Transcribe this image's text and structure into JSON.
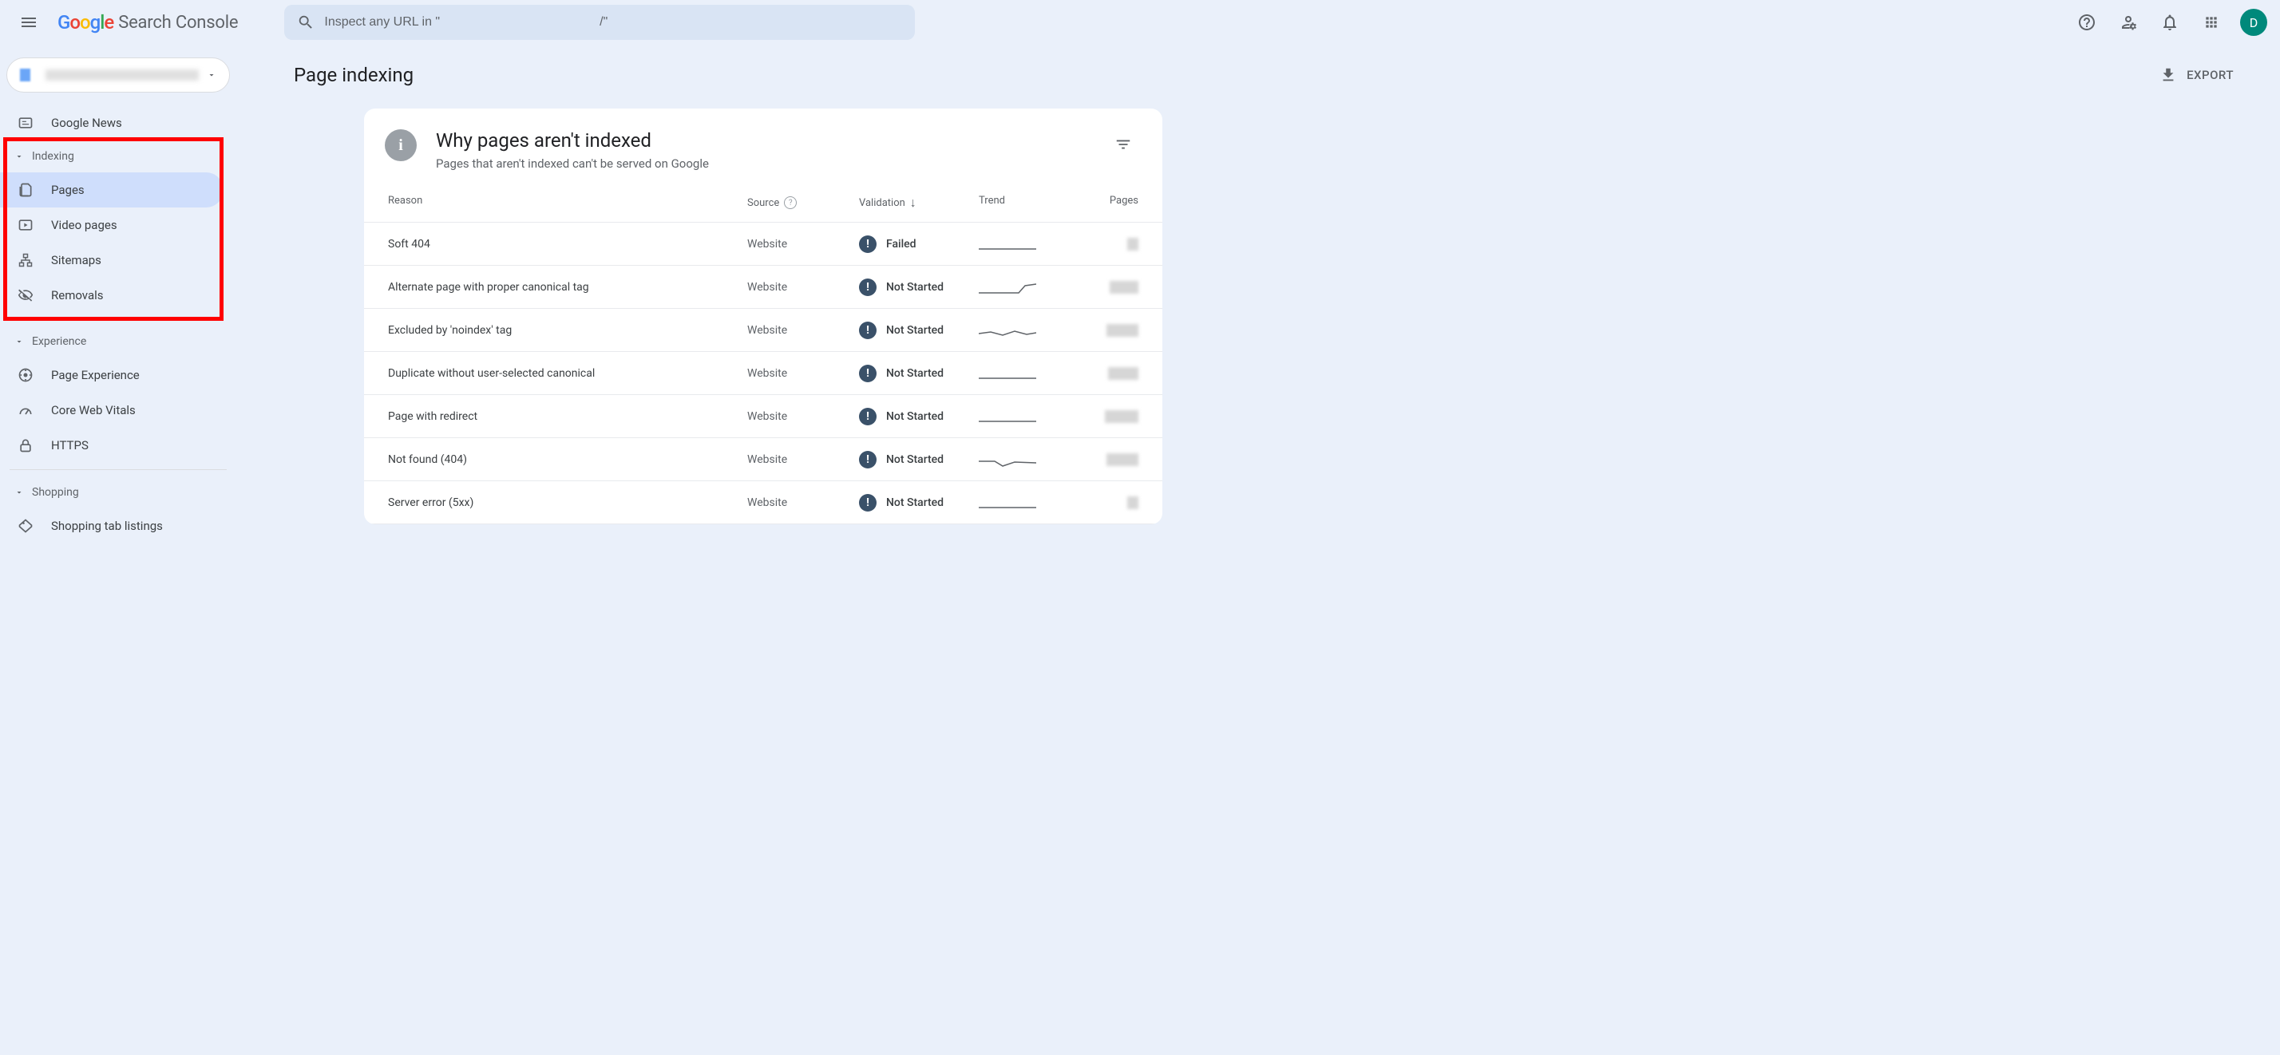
{
  "app": {
    "product_name": "Search Console",
    "search_placeholder": "Inspect any URL in \"                                             /\"",
    "avatar_letter": "D"
  },
  "sidebar": {
    "google_news": "Google News",
    "groups": {
      "indexing": {
        "label": "Indexing",
        "items": [
          {
            "label": "Pages",
            "icon": "pages-icon",
            "selected": true
          },
          {
            "label": "Video pages",
            "icon": "video-pages-icon"
          },
          {
            "label": "Sitemaps",
            "icon": "sitemaps-icon"
          },
          {
            "label": "Removals",
            "icon": "removals-icon"
          }
        ]
      },
      "experience": {
        "label": "Experience",
        "items": [
          {
            "label": "Page Experience",
            "icon": "page-experience-icon"
          },
          {
            "label": "Core Web Vitals",
            "icon": "core-web-vitals-icon"
          },
          {
            "label": "HTTPS",
            "icon": "https-icon"
          }
        ]
      },
      "shopping": {
        "label": "Shopping",
        "items": [
          {
            "label": "Shopping tab listings",
            "icon": "shopping-icon"
          }
        ]
      }
    }
  },
  "page": {
    "title": "Page indexing",
    "export_label": "EXPORT"
  },
  "card": {
    "title": "Why pages aren't indexed",
    "subtitle": "Pages that aren't indexed can't be served on Google",
    "columns": {
      "reason": "Reason",
      "source": "Source",
      "validation": "Validation",
      "trend": "Trend",
      "pages": "Pages"
    },
    "rows": [
      {
        "reason": "Soft 404",
        "source": "Website",
        "validation": "Failed",
        "trend": "flat",
        "pages_w": 14
      },
      {
        "reason": "Alternate page with proper canonical tag",
        "source": "Website",
        "validation": "Not Started",
        "trend": "up",
        "pages_w": 36
      },
      {
        "reason": "Excluded by 'noindex' tag",
        "source": "Website",
        "validation": "Not Started",
        "trend": "wavy",
        "pages_w": 40
      },
      {
        "reason": "Duplicate without user-selected canonical",
        "source": "Website",
        "validation": "Not Started",
        "trend": "flat",
        "pages_w": 38
      },
      {
        "reason": "Page with redirect",
        "source": "Website",
        "validation": "Not Started",
        "trend": "flat",
        "pages_w": 42
      },
      {
        "reason": "Not found (404)",
        "source": "Website",
        "validation": "Not Started",
        "trend": "dip",
        "pages_w": 40
      },
      {
        "reason": "Server error (5xx)",
        "source": "Website",
        "validation": "Not Started",
        "trend": "flat",
        "pages_w": 14
      }
    ]
  }
}
